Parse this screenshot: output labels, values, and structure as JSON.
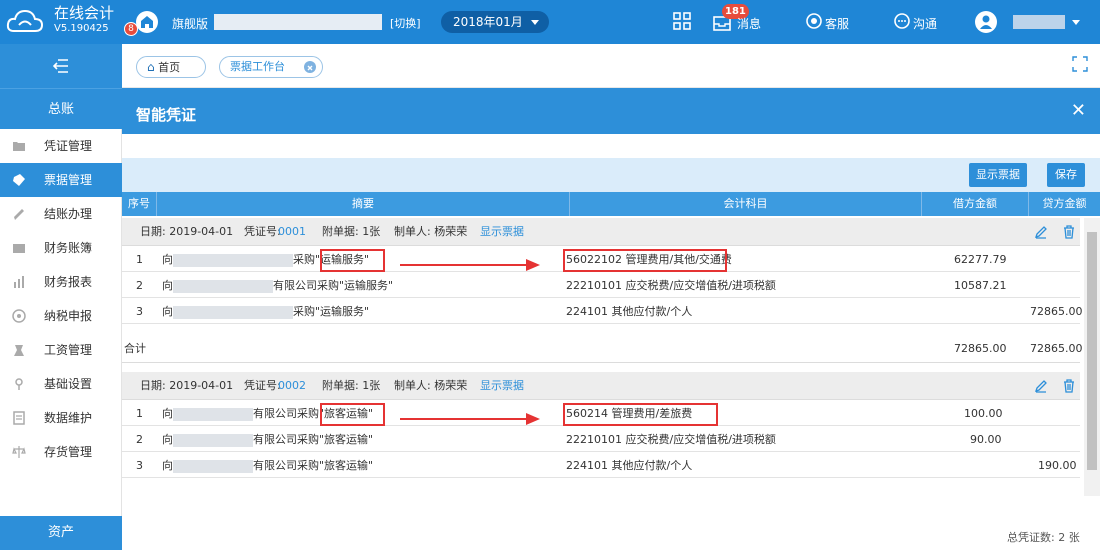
{
  "header": {
    "app_title": "在线会计",
    "version": "V5.190425",
    "version_badge": "8",
    "edition": "旗舰版",
    "switch_label": "[切换]",
    "period": "2018年01月",
    "message_count": "181",
    "message_label": "消息",
    "service_label": "客服",
    "chat_label": "沟通"
  },
  "sidebar": {
    "section": "总账",
    "items": [
      {
        "label": "凭证管理",
        "icon": "folder-icon"
      },
      {
        "label": "票据管理",
        "icon": "ticket-icon",
        "active": true
      },
      {
        "label": "结账办理",
        "icon": "pencil-icon"
      },
      {
        "label": "财务账簿",
        "icon": "book-icon"
      },
      {
        "label": "财务报表",
        "icon": "bar-chart-icon"
      },
      {
        "label": "纳税申报",
        "icon": "tax-icon"
      },
      {
        "label": "工资管理",
        "icon": "salary-icon"
      },
      {
        "label": "基础设置",
        "icon": "settings-icon"
      },
      {
        "label": "数据维护",
        "icon": "database-icon"
      },
      {
        "label": "存货管理",
        "icon": "inventory-icon"
      }
    ],
    "footer": "资产"
  },
  "tabs": [
    {
      "label": "首页"
    },
    {
      "label": "票据工作台"
    }
  ],
  "panel": {
    "title": "智能凭证",
    "show_bills_button": "显示票据",
    "save_button": "保存"
  },
  "table": {
    "headers": [
      "序号",
      "摘要",
      "会计科目",
      "借方金额",
      "贷方金额"
    ],
    "groups": [
      {
        "date": "日期: 2019-04-01",
        "voucher_label": "凭证号:",
        "voucher_no": "0001",
        "attachments": "附单据: 1张",
        "maker": "制单人: 杨荣荣",
        "show_link": "显示票据",
        "rows": [
          {
            "no": "1",
            "summary_prefix": "向",
            "summary_suffix": "采购\"运输服务\"",
            "account": "56022102 管理费用/其他/交通费",
            "debit": "62277.79",
            "credit": ""
          },
          {
            "no": "2",
            "summary_prefix": "向",
            "summary_suffix": "有限公司采购\"运输服务\"",
            "account": "22210101 应交税费/应交增值税/进项税额",
            "debit": "10587.21",
            "credit": ""
          },
          {
            "no": "3",
            "summary_prefix": "向",
            "summary_suffix": "采购\"运输服务\"",
            "account": "224101 其他应付款/个人",
            "debit": "",
            "credit": "72865.00"
          }
        ],
        "total_label": "合计",
        "total_debit": "72865.00",
        "total_credit": "72865.00"
      },
      {
        "date": "日期: 2019-04-01",
        "voucher_label": "凭证号:",
        "voucher_no": "0002",
        "attachments": "附单据: 1张",
        "maker": "制单人: 杨荣荣",
        "show_link": "显示票据",
        "rows": [
          {
            "no": "1",
            "summary_prefix": "向",
            "summary_suffix": "有限公司采购\"旅客运输\"",
            "account": "560214 管理费用/差旅费",
            "debit": "100.00",
            "credit": ""
          },
          {
            "no": "2",
            "summary_prefix": "向",
            "summary_suffix": "有限公司采购\"旅客运输\"",
            "account": "22210101 应交税费/应交增值税/进项税额",
            "debit": "90.00",
            "credit": ""
          },
          {
            "no": "3",
            "summary_prefix": "向",
            "summary_suffix": "有限公司采购\"旅客运输\"",
            "account": "224101 其他应付款/个人",
            "debit": "",
            "credit": "190.00"
          }
        ]
      }
    ]
  },
  "footer": {
    "count_text": "总凭证数: 2 张"
  },
  "colors": {
    "primary": "#2d8fd9",
    "header": "#1f86d6",
    "highlight": "#e53333"
  }
}
